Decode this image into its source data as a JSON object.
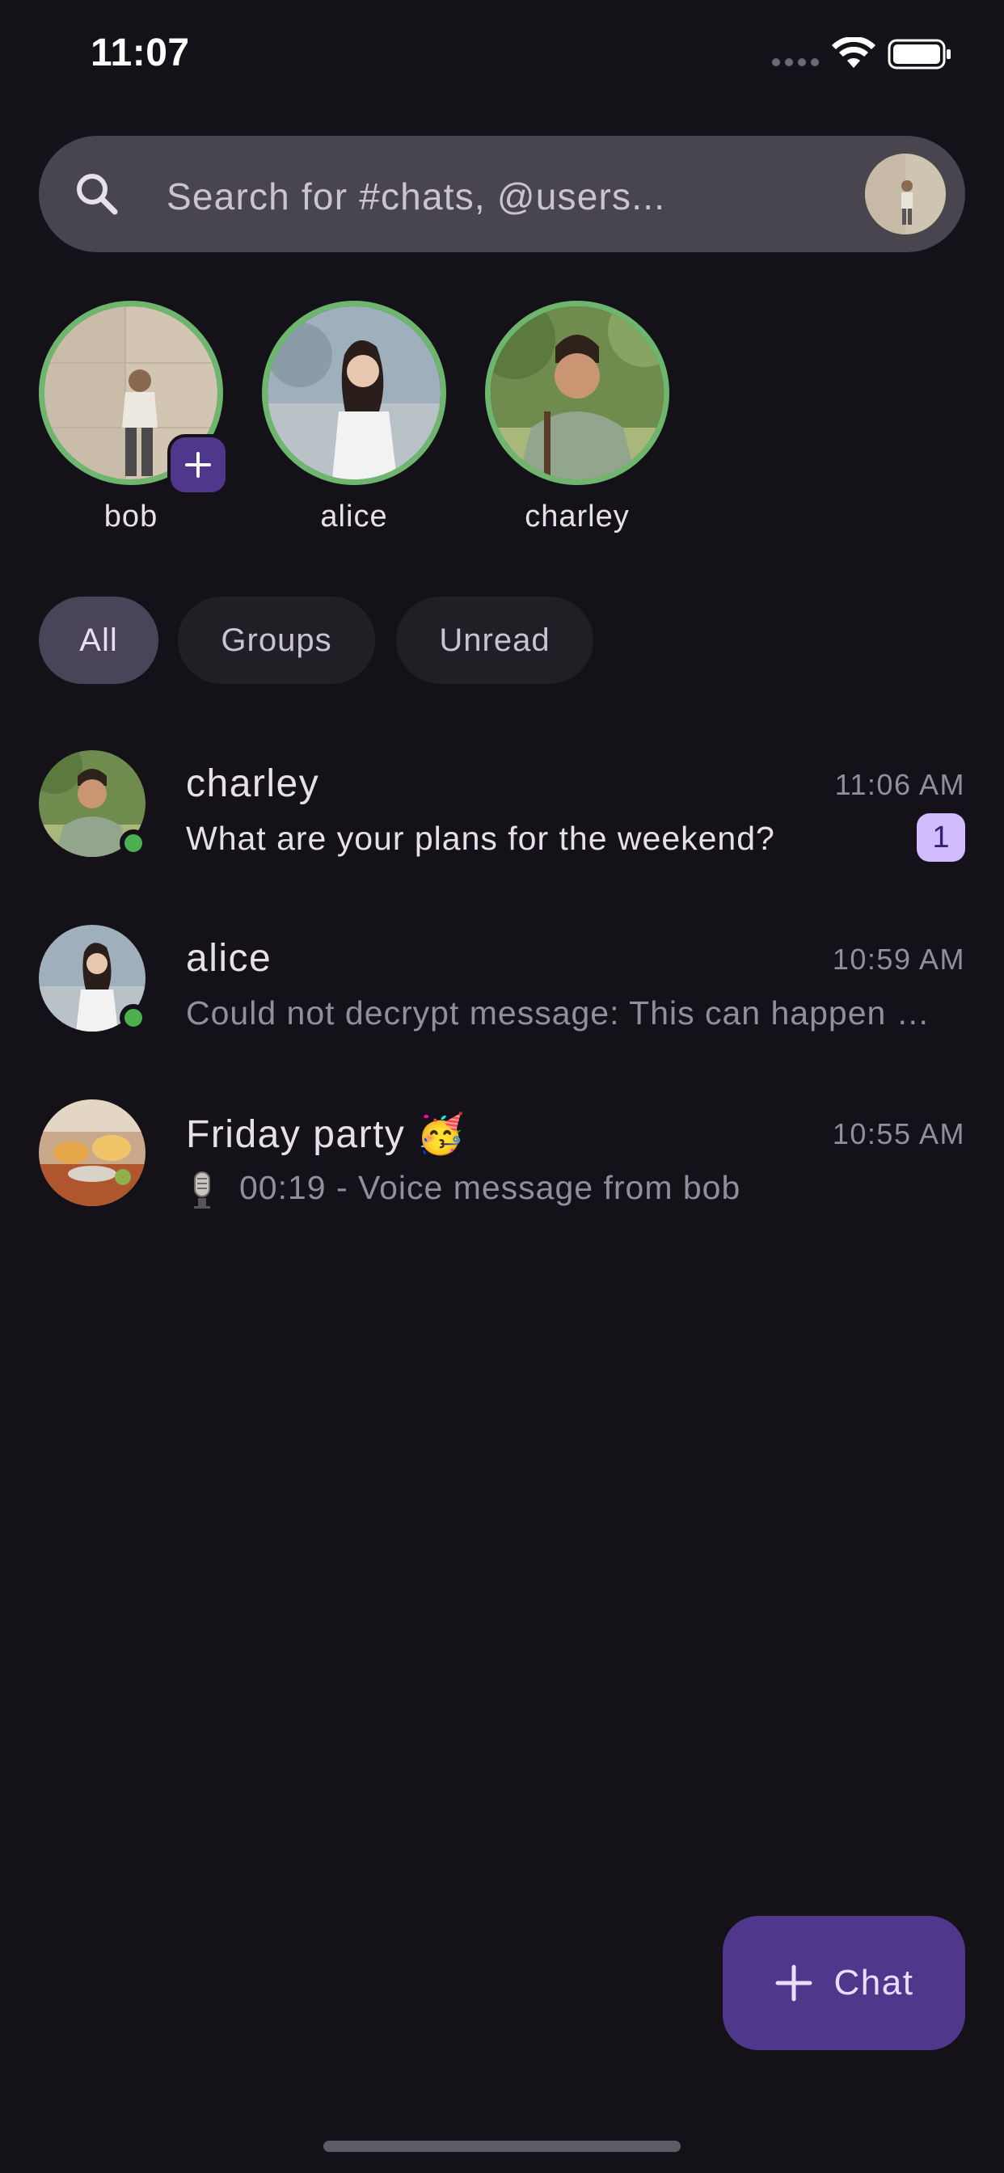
{
  "status_bar": {
    "time": "11:07"
  },
  "search": {
    "placeholder": "Search for #chats, @users..."
  },
  "stories": [
    {
      "name": "bob"
    },
    {
      "name": "alice"
    },
    {
      "name": "charley"
    }
  ],
  "filters": [
    {
      "label": "All",
      "active": true
    },
    {
      "label": "Groups",
      "active": false
    },
    {
      "label": "Unread",
      "active": false
    }
  ],
  "chats": [
    {
      "name": "charley",
      "time": "11:06 AM",
      "preview": "What are your plans for the weekend?",
      "unread": "1",
      "online": true
    },
    {
      "name": "alice",
      "time": "10:59 AM",
      "preview": "Could not decrypt message: This can happen because the message was sent before you joined",
      "online": true
    },
    {
      "name": "Friday party",
      "emoji": "🥳",
      "time": "10:55 AM",
      "preview": "00:19 - Voice message from bob",
      "icon": "microphone-icon"
    }
  ],
  "fab": {
    "label": "Chat",
    "icon": "plus-icon"
  },
  "colors": {
    "background": "#141218",
    "accent": "#4F378B",
    "online": "#4CAF50",
    "story_ring": "#6EB56E",
    "badge": "#D0BCFF"
  }
}
